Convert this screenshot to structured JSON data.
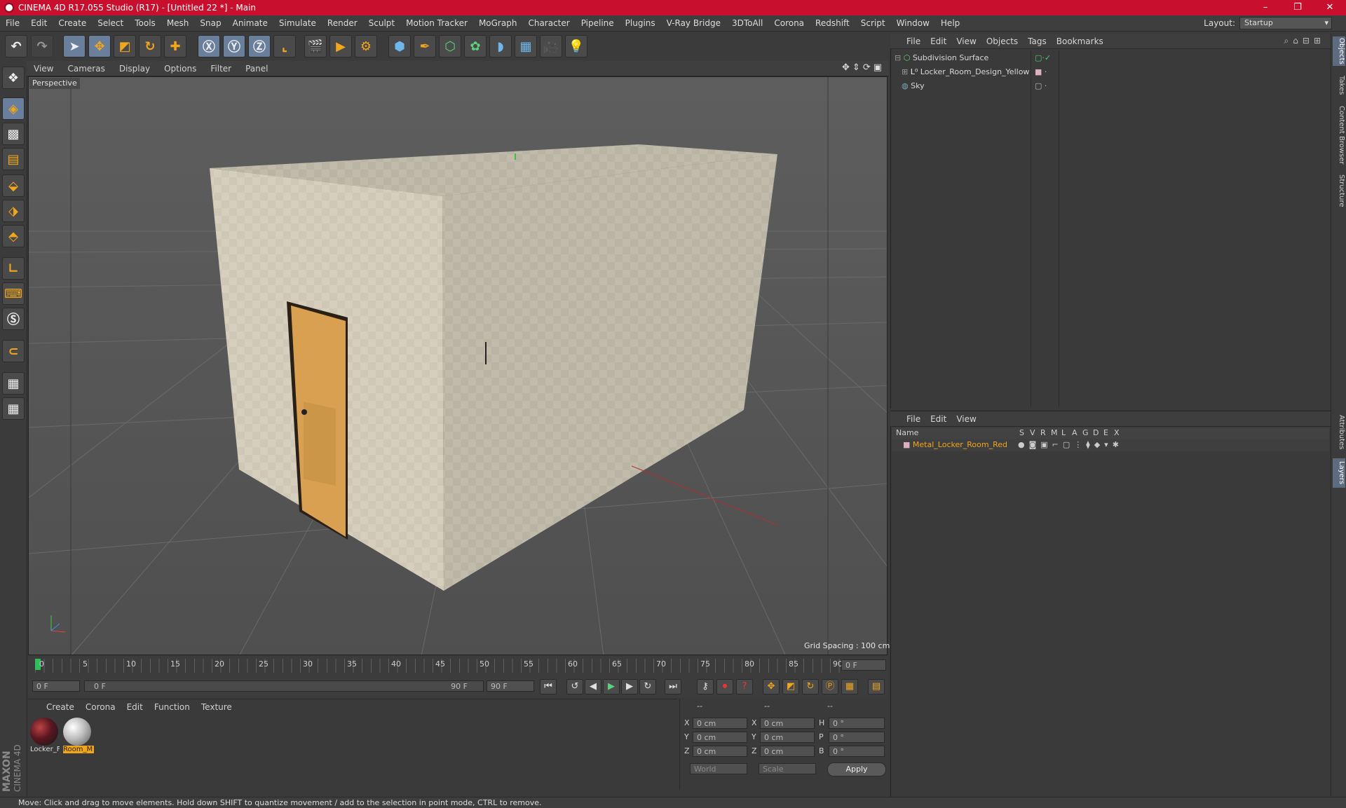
{
  "window": {
    "title": "CINEMA 4D R17.055 Studio (R17) - [Untitled 22 *] - Main",
    "controls": [
      "–",
      "❐",
      "✕"
    ]
  },
  "menu": [
    "File",
    "Edit",
    "Create",
    "Select",
    "Tools",
    "Mesh",
    "Snap",
    "Animate",
    "Simulate",
    "Render",
    "Sculpt",
    "Motion Tracker",
    "MoGraph",
    "Character",
    "Pipeline",
    "Plugins",
    "V-Ray Bridge",
    "3DToAll",
    "Corona",
    "Redshift",
    "Script",
    "Window",
    "Help"
  ],
  "layout": {
    "label": "Layout:",
    "value": "Startup"
  },
  "viewport": {
    "menu": [
      "View",
      "Cameras",
      "Display",
      "Options",
      "Filter",
      "Panel"
    ],
    "label": "Perspective",
    "grid_spacing": "Grid Spacing : 100 cm"
  },
  "timeline": {
    "ticks": [
      "0",
      "5",
      "10",
      "15",
      "20",
      "25",
      "30",
      "35",
      "40",
      "45",
      "50",
      "55",
      "60",
      "65",
      "70",
      "75",
      "80",
      "85",
      "90"
    ],
    "current_frame": "0 F",
    "start_field": "0 F",
    "slider_left": "0 F",
    "slider_right": "90 F",
    "end_field": "90 F"
  },
  "materials": {
    "menu": [
      "Create",
      "Corona",
      "Edit",
      "Function",
      "Texture"
    ],
    "items": [
      {
        "label": "Locker_F"
      },
      {
        "label": "Room_M"
      }
    ]
  },
  "coords": {
    "headers": [
      "--",
      "--",
      "--"
    ],
    "rows": [
      {
        "a": "X",
        "v1": "0 cm",
        "b": "X",
        "v2": "0 cm",
        "c": "H",
        "v3": "0 °"
      },
      {
        "a": "Y",
        "v1": "0 cm",
        "b": "Y",
        "v2": "0 cm",
        "c": "P",
        "v3": "0 °"
      },
      {
        "a": "Z",
        "v1": "0 cm",
        "b": "Z",
        "v2": "0 cm",
        "c": "B",
        "v3": "0 °"
      }
    ],
    "world": "World",
    "scale": "Scale",
    "apply": "Apply"
  },
  "objects": {
    "menu": [
      "File",
      "Edit",
      "View",
      "Objects",
      "Tags",
      "Bookmarks"
    ],
    "items": [
      {
        "name": "Subdivision Surface"
      },
      {
        "name": "Locker_Room_Design_Yellow"
      },
      {
        "name": "Sky"
      }
    ]
  },
  "layers": {
    "menu": [
      "File",
      "Edit",
      "View"
    ],
    "columns": [
      "Name",
      "S",
      "V",
      "R",
      "M",
      "L",
      "A",
      "G",
      "D",
      "E",
      "X"
    ],
    "items": [
      {
        "name": "Metal_Locker_Room_Red"
      }
    ]
  },
  "right_tabs": [
    "Objects",
    "Takes",
    "Content Browser",
    "Structure",
    "Attributes",
    "Layers"
  ],
  "status": "Move: Click and drag to move elements. Hold down SHIFT to quantize movement / add to the selection in point mode, CTRL to remove.",
  "brand": {
    "line1": "MAXON",
    "line2": "CINEMA 4D"
  },
  "colors": {
    "titlebar": "#c8102e",
    "accent": "#f2a61b",
    "selection": "#6a7f9c"
  }
}
